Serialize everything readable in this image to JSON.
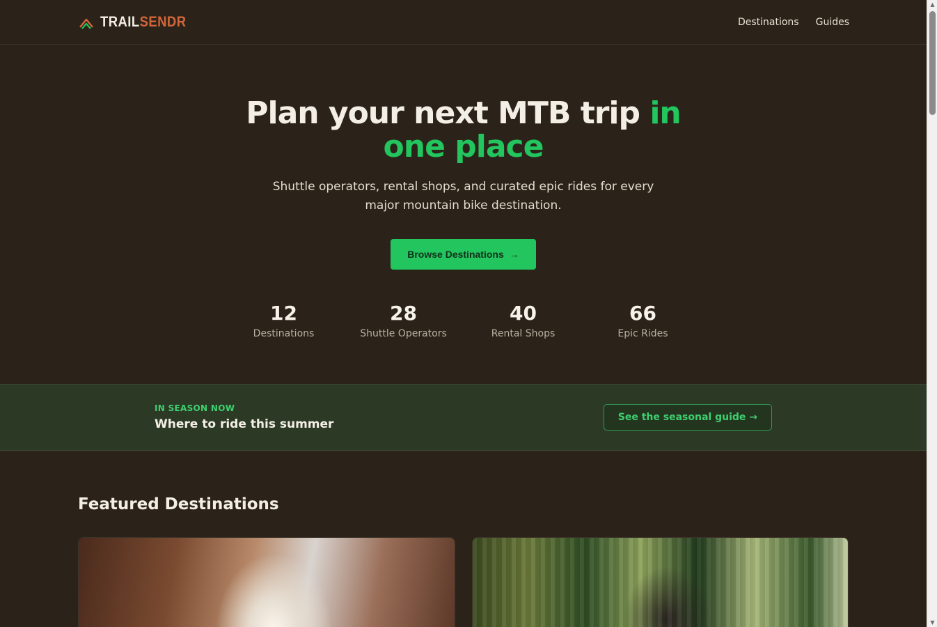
{
  "header": {
    "logo_primary": "TRAIL",
    "logo_accent": "SENDR",
    "nav": [
      {
        "label": "Destinations"
      },
      {
        "label": "Guides"
      }
    ]
  },
  "hero": {
    "title_main": "Plan your next MTB trip ",
    "title_accent": "in one place",
    "subtitle": "Shuttle operators, rental shops, and curated epic rides for every major mountain bike destination.",
    "cta_label": "Browse Destinations",
    "cta_icon": "→"
  },
  "stats": [
    {
      "value": "12",
      "label": "Destinations"
    },
    {
      "value": "28",
      "label": "Shuttle Operators"
    },
    {
      "value": "40",
      "label": "Rental Shops"
    },
    {
      "value": "66",
      "label": "Epic Rides"
    }
  ],
  "season": {
    "eyebrow": "IN SEASON NOW",
    "title": "Where to ride this summer",
    "button_label": "See the seasonal guide →"
  },
  "featured": {
    "title": "Featured Destinations"
  },
  "colors": {
    "background": "#2b2319",
    "accent_green": "#22c55e",
    "logo_orange": "#d2663a",
    "season_bg": "#2c3a25"
  },
  "icons": {
    "logo": "mountain-chevron-icon",
    "cta_arrow": "arrow-right-icon"
  }
}
